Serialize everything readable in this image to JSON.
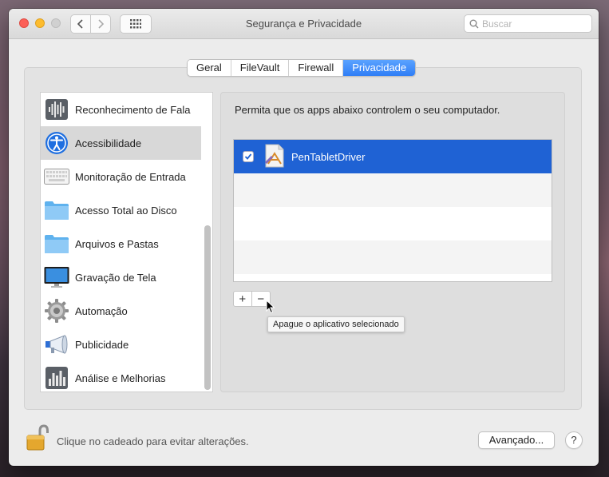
{
  "window": {
    "title": "Segurança e Privacidade",
    "search_placeholder": "Buscar"
  },
  "tabs": [
    {
      "label": "Geral",
      "active": false
    },
    {
      "label": "FileVault",
      "active": false
    },
    {
      "label": "Firewall",
      "active": false
    },
    {
      "label": "Privacidade",
      "active": true
    }
  ],
  "categories": [
    {
      "label": "Reconhecimento de Fala",
      "icon": "speech-waveform-icon"
    },
    {
      "label": "Acessibilidade",
      "icon": "accessibility-icon",
      "selected": true
    },
    {
      "label": "Monitoração de Entrada",
      "icon": "keyboard-icon"
    },
    {
      "label": "Acesso Total ao Disco",
      "icon": "folder-icon"
    },
    {
      "label": "Arquivos e Pastas",
      "icon": "folder-icon"
    },
    {
      "label": "Gravação de Tela",
      "icon": "display-icon"
    },
    {
      "label": "Automação",
      "icon": "gear-icon"
    },
    {
      "label": "Publicidade",
      "icon": "megaphone-icon"
    },
    {
      "label": "Análise e Melhorias",
      "icon": "bar-chart-icon"
    }
  ],
  "detail": {
    "description": "Permita que os apps abaixo controlem o seu computador.",
    "apps": [
      {
        "name": "PenTabletDriver",
        "checked": true,
        "selected": true,
        "icon": "app-installer-icon"
      }
    ],
    "add_symbol": "+",
    "remove_symbol": "−",
    "tooltip": "Apague o aplicativo selecionado"
  },
  "footer": {
    "lock_text": "Clique no cadeado para evitar alterações.",
    "advanced_label": "Avançado...",
    "help_label": "?"
  },
  "colors": {
    "accent": "#1f62d4",
    "tab_active": "#2f7ef6",
    "close": "#fc5f57",
    "minimize": "#fdbc2e"
  }
}
